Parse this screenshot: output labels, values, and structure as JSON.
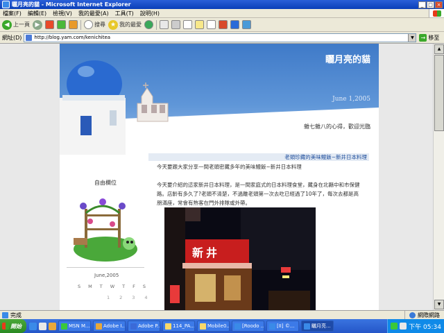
{
  "window": {
    "title": "矖月亮的貓 - Microsoft Internet Explorer"
  },
  "menu": [
    "檔案(F)",
    "編輯(E)",
    "檢視(V)",
    "我的最愛(A)",
    "工具(T)",
    "說明(H)"
  ],
  "toolbar": {
    "back_label": "上一頁",
    "search_label": "搜尋",
    "favorites_label": "我的最愛"
  },
  "address": {
    "label": "網址(D)",
    "url": "http://blog.yam.com/kenichitea",
    "go_label": "移至"
  },
  "blog": {
    "title": "矖月亮的貓",
    "date": "June 1,2005",
    "tagline": "雜七雜八的心得，歡迎光臨",
    "post_title": "老頭珍藏的美味鰻飯~新井日本料理",
    "post_lines": [
      "今天要跟大家分享一間老頭密藏多年的美味鰻飯~新井日本料理",
      "",
      "今天要介紹的這家新井日本料理，是一間家庭式的日本料理食堂，藏身在北縣中和市保健",
      "路。店齡有多久了?老頭不清楚，不過離老頭第一次去吃已經過了10年了，每次去都是高",
      "朋滿座，常會有熟客在門外排隊或外帶。"
    ],
    "sign_text": "新井",
    "side_label": "自由欄位",
    "calendar": {
      "month": "June,2005",
      "days": [
        "S",
        "M",
        "T",
        "W",
        "T",
        "F",
        "S"
      ],
      "first_row": [
        "",
        "",
        "",
        "1",
        "2",
        "3",
        "4"
      ]
    }
  },
  "status": {
    "text": "完成",
    "zone": "網際網路"
  },
  "taskbar": {
    "start_label": "開始",
    "buttons": [
      "MSN M...",
      "Adobe I...",
      "Adobe P...",
      "114_PA...",
      "Mobile0...",
      "[Roodo ...",
      "[II] ©...",
      "矖月亮..."
    ],
    "clock": "下午 05:34"
  }
}
